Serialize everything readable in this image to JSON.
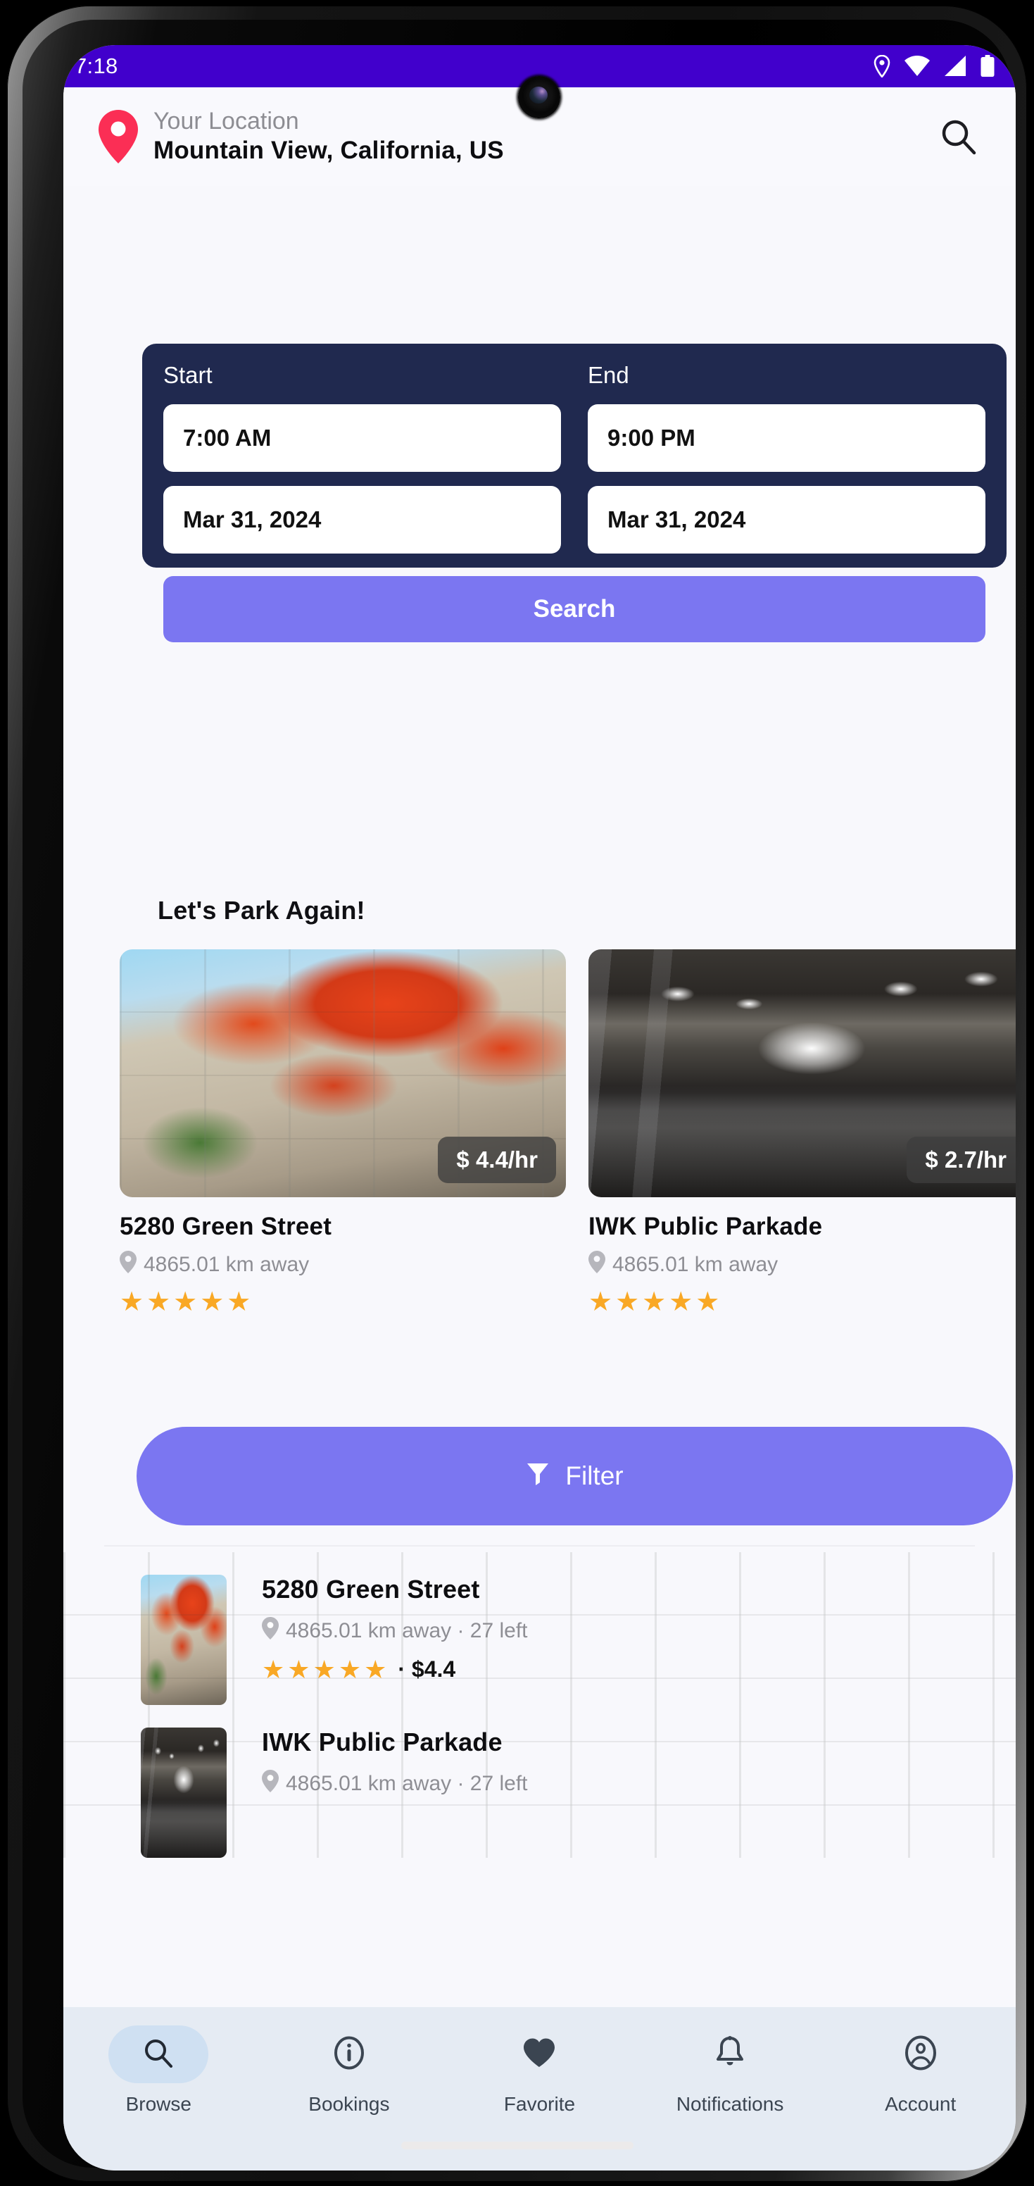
{
  "status_bar": {
    "time": "7:18",
    "icons": [
      "location-icon",
      "wifi-icon",
      "signal-icon",
      "battery-icon"
    ],
    "background": "#4100cc"
  },
  "header": {
    "pin_icon": "map-pin-icon",
    "label": "Your Location",
    "value": "Mountain View,  California,  US",
    "search_icon": "search-icon"
  },
  "search_card": {
    "background": "#20294f",
    "start_label": "Start",
    "end_label": "End",
    "start_time": "7:00 AM",
    "end_time": "9:00 PM",
    "start_date": "Mar 31, 2024",
    "end_date": "Mar 31, 2024",
    "search_button": "Search",
    "accent": "#7b76f1"
  },
  "recent": {
    "title": "Let's Park Again!",
    "cards": [
      {
        "name": "5280 Green Street",
        "price_badge": "$ 4.4/hr",
        "distance": "4865.01 km away",
        "stars": "★★★★★",
        "rating": 5,
        "photo": "autumn-tree-street-photo"
      },
      {
        "name": "IWK Public Parkade",
        "price_badge": "$ 2.7/hr",
        "distance": "4865.01 km away",
        "stars": "★★★★★",
        "rating": 5,
        "photo": "parking-garage-photo"
      }
    ]
  },
  "filter": {
    "label": "Filter",
    "icon": "filter-funnel-icon",
    "color": "#7b76f1"
  },
  "results": [
    {
      "name": "5280 Green Street",
      "meta": "4865.01 km away · 27 left",
      "stars": "★★★★★",
      "rating": 5,
      "price": "· $4.4",
      "photo": "autumn-tree-street-photo"
    },
    {
      "name": "IWK Public Parkade",
      "meta": "4865.01 km away · 27 left",
      "photo": "parking-garage-photo"
    }
  ],
  "bottom_nav": {
    "items": [
      {
        "label": "Browse",
        "icon": "search-icon",
        "active": true
      },
      {
        "label": "Bookings",
        "icon": "info-circle-icon",
        "active": false
      },
      {
        "label": "Favorite",
        "icon": "heart-icon",
        "active": false
      },
      {
        "label": "Notifications",
        "icon": "bell-icon",
        "active": false
      },
      {
        "label": "Account",
        "icon": "account-circle-icon",
        "active": false
      }
    ]
  }
}
